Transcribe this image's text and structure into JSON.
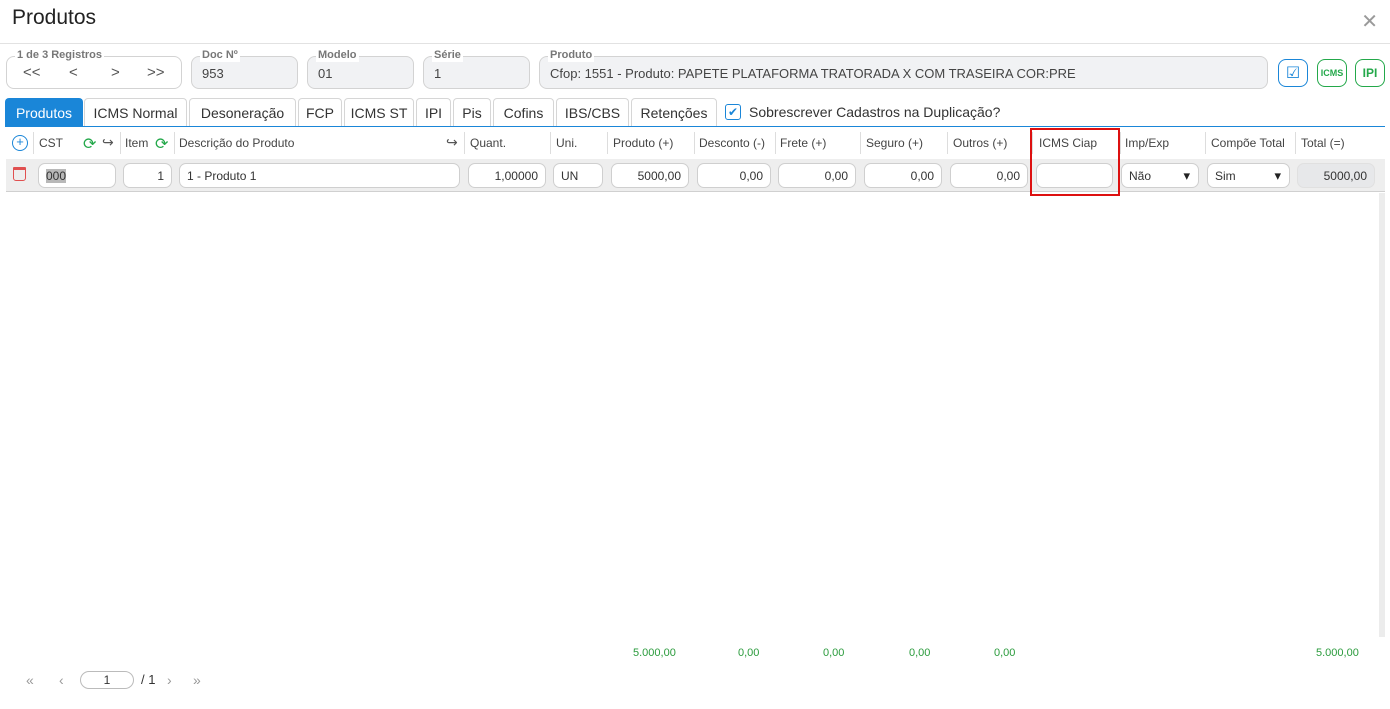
{
  "header": {
    "title": "Produtos",
    "close_icon": "close-icon"
  },
  "records": {
    "label": "1 de 3 Registros",
    "nav": [
      "<<",
      "<",
      ">",
      ">>"
    ]
  },
  "fields": {
    "doc": {
      "label": "Doc Nº",
      "value": "953"
    },
    "modelo": {
      "label": "Modelo",
      "value": "01"
    },
    "serie": {
      "label": "Série",
      "value": "1"
    },
    "produto": {
      "label": "Produto",
      "value": "Cfop: 1551 - Produto: PAPETE PLATAFORMA TRATORADA X COM TRASEIRA COR:PRE"
    }
  },
  "badges": {
    "check_color": "#1a86d8",
    "icms_label": "ICMS",
    "ipi_label": "IPI",
    "green": "#23a84a"
  },
  "tabs": [
    "Produtos",
    "ICMS Normal",
    "Desoneração",
    "FCP",
    "ICMS ST",
    "IPI",
    "Pis",
    "Cofins",
    "IBS/CBS",
    "Retenções"
  ],
  "active_tab": "Produtos",
  "overwrite": {
    "checked": true,
    "label": "Sobrescrever Cadastros na Duplicação?"
  },
  "columns": {
    "cst": "CST",
    "item": "Item",
    "descricao": "Descrição do Produto",
    "quant": "Quant.",
    "uni": "Uni.",
    "produto": "Produto (+)",
    "desconto": "Desconto (-)",
    "frete": "Frete (+)",
    "seguro": "Seguro (+)",
    "outros": "Outros (+)",
    "icms_ciap": "ICMS Ciap",
    "imp_exp": "Imp/Exp",
    "compoe_total": "Compõe Total",
    "total": "Total (=)"
  },
  "row": {
    "cst": "000",
    "item": "1",
    "descricao": "1 - Produto 1",
    "quant": "1,00000",
    "uni": "UN",
    "produto": "5000,00",
    "desconto": "0,00",
    "frete": "0,00",
    "seguro": "0,00",
    "outros": "0,00",
    "icms_ciap": "",
    "imp_exp": "Não",
    "compoe_total": "Sim",
    "total": "5000,00"
  },
  "totals": {
    "produto": "5.000,00",
    "desconto": "0,00",
    "frete": "0,00",
    "seguro": "0,00",
    "outros": "0,00",
    "total": "5.000,00"
  },
  "pager": {
    "current": "1",
    "total": "/ 1"
  }
}
